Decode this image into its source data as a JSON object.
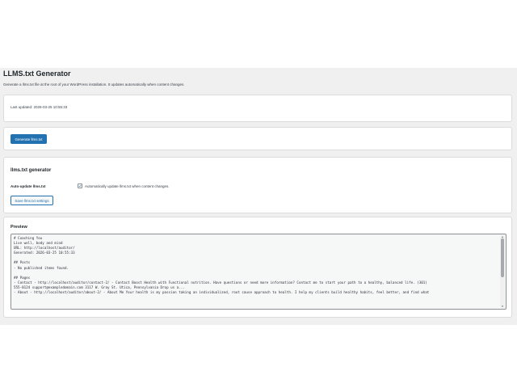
{
  "header": {
    "title": "LLMS.txt Generator",
    "description": "Generate a llms.txt file at the root of your WordPress installation. It updates automatically when content changes."
  },
  "status": {
    "last_updated": "Last updated: 2026-03-25 10:55:33"
  },
  "actions": {
    "generate_label": "Generate llms.txt"
  },
  "settings": {
    "section_title": "llms.txt generator",
    "auto_update_label": "Auto-update llms.txt",
    "auto_update_checked": true,
    "auto_update_description": "Automatically update llms.txt when content changes.",
    "save_label": "Save llms.txt settings"
  },
  "preview": {
    "title": "Preview",
    "content": "# Coaching You\nLive well, body and mind\nURL: http://localhost/auditor/\nGenerated: 2026-03-25 10:55:33\n\n## Posts\n- No published items found.\n\n## Pages\n- Contact - http://localhost/auditor/contact-2/ - Contact Boost Health with Functional nutrition. Have questions or need more information? Contact me to start your path to a healthy, balanced life. (301)\n555-0124 support@exampledomain.com 3117 W. Gray St. Utica, Pennsylvania Drop us a...\n- About - http://localhost/auditor/about-2/ - About Me Your health is my passion taking an individualized, root cause approach to health. I help my clients build healthy habits, feel better, and find what"
  },
  "colors": {
    "primary": "#2271b1",
    "background": "#f0f0f1",
    "card": "#ffffff"
  }
}
